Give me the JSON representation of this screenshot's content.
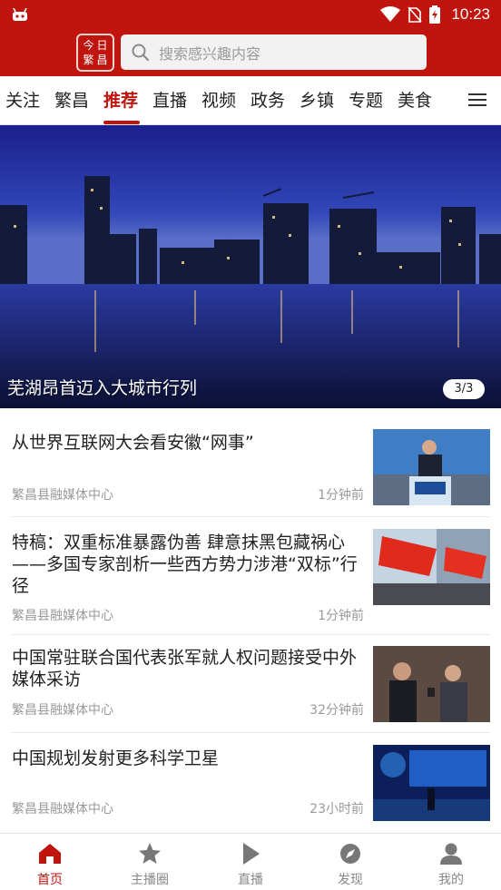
{
  "status_bar": {
    "time": "10:23"
  },
  "header": {
    "logo_chars": [
      "今",
      "日",
      "繁",
      "昌"
    ],
    "search_placeholder": "搜索感兴趣内容"
  },
  "tabs": [
    {
      "label": "关注"
    },
    {
      "label": "繁昌"
    },
    {
      "label": "推荐",
      "active": true
    },
    {
      "label": "直播"
    },
    {
      "label": "视频"
    },
    {
      "label": "政务"
    },
    {
      "label": "乡镇"
    },
    {
      "label": "专题"
    },
    {
      "label": "美食"
    }
  ],
  "banner": {
    "caption": "芜湖昂首迈入大城市行列",
    "counter": "3/3"
  },
  "news": [
    {
      "title": "从世界互联网大会看安徽“网事”",
      "source": "繁昌县融媒体中心",
      "time": "1分钟前"
    },
    {
      "title": "特稿：双重标准暴露伪善 肆意抹黑包藏祸心——多国专家剖析一些西方势力涉港“双标”行径",
      "source": "繁昌县融媒体中心",
      "time": "1分钟前"
    },
    {
      "title": "中国常驻联合国代表张军就人权问题接受中外媒体采访",
      "source": "繁昌县融媒体中心",
      "time": "32分钟前"
    },
    {
      "title": "中国规划发射更多科学卫星",
      "source": "繁昌县融媒体中心",
      "time": "23小时前"
    }
  ],
  "bottom_nav": [
    {
      "label": "首页",
      "icon": "home-icon",
      "active": true
    },
    {
      "label": "主播圈",
      "icon": "star-icon"
    },
    {
      "label": "直播",
      "icon": "play-icon"
    },
    {
      "label": "发现",
      "icon": "compass-icon"
    },
    {
      "label": "我的",
      "icon": "user-icon"
    }
  ],
  "colors": {
    "brand": "#c0150e",
    "muted_text": "#999999"
  }
}
